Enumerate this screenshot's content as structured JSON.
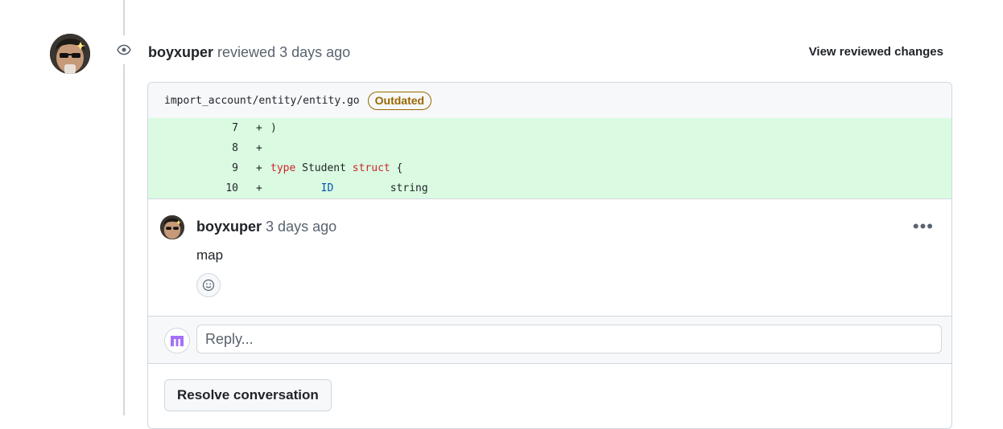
{
  "review": {
    "author": "boyxuper",
    "action": "reviewed",
    "time": "3 days ago",
    "view_changes_label": "View reviewed changes"
  },
  "file": {
    "path": "import_account/entity/entity.go",
    "badge": "Outdated"
  },
  "diff_lines": [
    {
      "num": "7",
      "marker": "+",
      "code": ")"
    },
    {
      "num": "8",
      "marker": "+",
      "code": ""
    },
    {
      "num": "9",
      "marker": "+",
      "code": "type Student struct {"
    },
    {
      "num": "10",
      "marker": "+",
      "code": "        ID         string"
    }
  ],
  "comment": {
    "author": "boyxuper",
    "time": "3 days ago",
    "body": "map",
    "menu_label": "•••"
  },
  "reply": {
    "placeholder": "Reply..."
  },
  "resolve_label": "Resolve conversation",
  "icons": [
    "eye-icon",
    "kebab-menu-icon",
    "smiley-icon",
    "user-avatar",
    "reply-avatar"
  ],
  "colors": {
    "diff_add_bg": "#dafbe1",
    "outdated": "#9a6700",
    "keyword": "#cf222e",
    "identifier": "#0550ae"
  }
}
